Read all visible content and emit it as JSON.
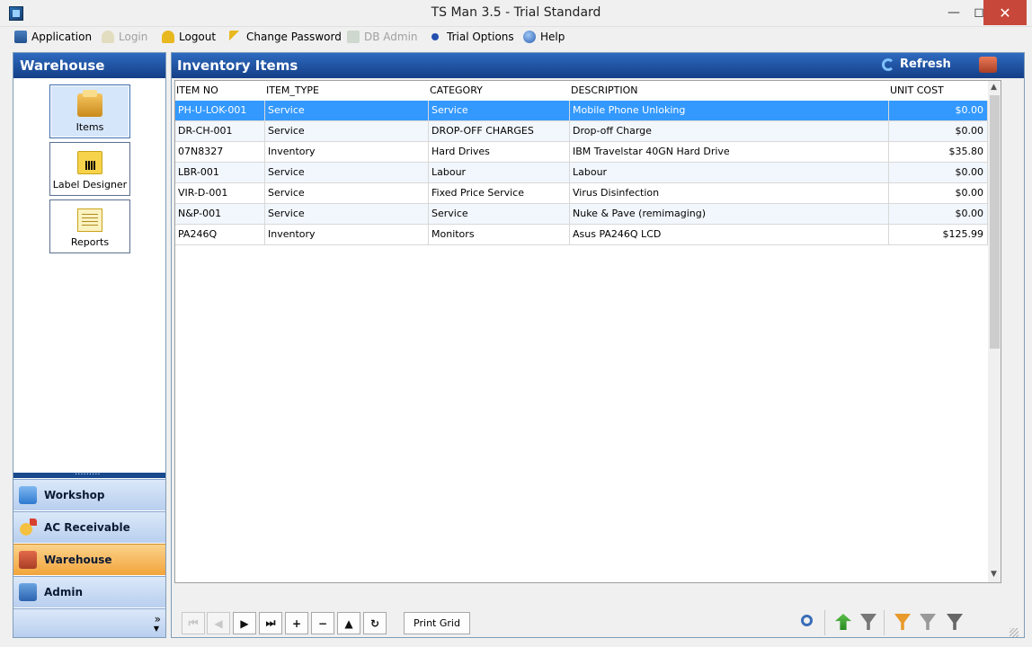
{
  "window": {
    "title": "TS Man 3.5 - Trial Standard"
  },
  "menu": {
    "application": "Application",
    "login": "Login",
    "logout": "Logout",
    "change_password": "Change Password",
    "db_admin": "DB Admin",
    "trial_options": "Trial Options",
    "help": "Help"
  },
  "sidebar": {
    "title": "Warehouse",
    "buttons": [
      {
        "label": "Items",
        "icon": "items-box-icon",
        "active": true
      },
      {
        "label": "Label Designer",
        "icon": "barcode-label-icon",
        "active": false
      },
      {
        "label": "Reports",
        "icon": "report-sheet-icon",
        "active": false
      }
    ],
    "sections": [
      {
        "label": "Workshop",
        "icon": "workshop-icon",
        "selected": false
      },
      {
        "label": "AC Receivable",
        "icon": "receivable-icon",
        "selected": false
      },
      {
        "label": "Warehouse",
        "icon": "warehouse-icon",
        "selected": true
      },
      {
        "label": "Admin",
        "icon": "admin-icon",
        "selected": false
      }
    ],
    "footer_chevron": "»",
    "footer_dropdown": "▼"
  },
  "main": {
    "title": "Inventory Items",
    "refresh_label": "Refresh",
    "columns": [
      "ITEM NO",
      "ITEM_TYPE",
      "CATEGORY",
      "DESCRIPTION",
      "UNIT COST"
    ],
    "rows": [
      [
        "PH-U-LOK-001",
        "Service",
        "Service",
        "Mobile Phone Unloking",
        "$0.00"
      ],
      [
        "DR-CH-001",
        "Service",
        "DROP-OFF CHARGES",
        "Drop-off Charge",
        "$0.00"
      ],
      [
        "07N8327",
        "Inventory",
        "Hard Drives",
        "IBM Travelstar 40GN Hard Drive",
        "$35.80"
      ],
      [
        "LBR-001",
        "Service",
        "Labour",
        "Labour",
        "$0.00"
      ],
      [
        "VIR-D-001",
        "Service",
        "Fixed Price Service",
        "Virus Disinfection",
        "$0.00"
      ],
      [
        "N&P-001",
        "Service",
        "Service",
        "Nuke & Pave (remimaging)",
        "$0.00"
      ],
      [
        "PA246Q",
        "Inventory",
        "Monitors",
        "Asus PA246Q LCD",
        "$125.99"
      ]
    ],
    "selected_row": 0,
    "print_label": "Print Grid"
  },
  "colors": {
    "header_blue": "#1f55a6",
    "selection": "#3399ff",
    "selected_section": "#f5b24c"
  }
}
